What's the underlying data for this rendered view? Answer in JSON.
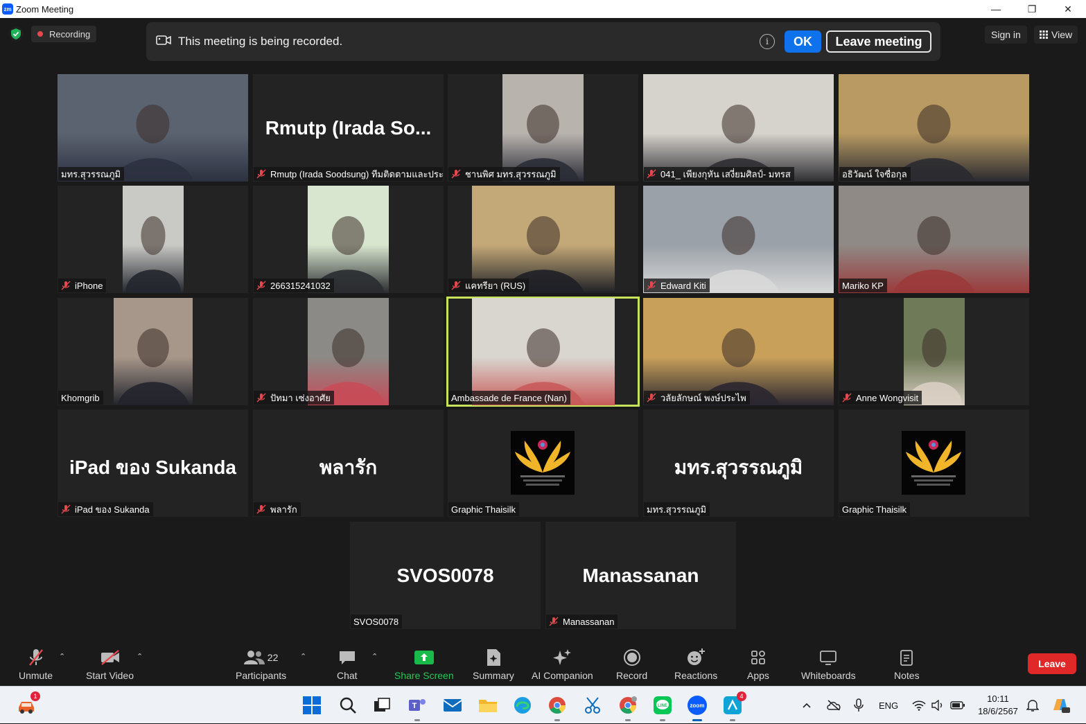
{
  "window": {
    "title": "Zoom Meeting",
    "logo_text": "zm",
    "minimize": "—",
    "maximize": "❐",
    "close": "✕"
  },
  "topbar": {
    "recording_label": "Recording",
    "banner_message": "This meeting is being recorded.",
    "ok_label": "OK",
    "leave_meeting_label": "Leave meeting",
    "sign_in_label": "Sign in",
    "view_label": "View"
  },
  "tiles": [
    {
      "label": "มทร.สุวรรณภูมิ",
      "type": "video",
      "muted": false,
      "bg": "#5b6270",
      "accent": "#2c3140"
    },
    {
      "label": "Rmutp (Irada Soodsung) ทีมติดตามและประ...",
      "type": "name",
      "display": "Rmutp (Irada So...",
      "muted": true
    },
    {
      "label": "ชานพิศ มทร.สุวรรณภูมิ",
      "type": "video",
      "muted": true,
      "bg": "#b9b3ae",
      "accent": "#2a2c36"
    },
    {
      "label": "041_ เพียงกุหัน เสงี่ยมศิลป์- มทรส",
      "type": "video",
      "muted": true,
      "bg": "#d6d2cc",
      "accent": "#2f2f33"
    },
    {
      "label": "อธิวัฒน์ ใจซื่อกุล",
      "type": "video",
      "muted": false,
      "bg": "#b89a62",
      "accent": "#2a2a30"
    },
    {
      "label": "iPhone",
      "type": "video",
      "muted": true,
      "bg": "#c9c9c5",
      "accent": "#24262e"
    },
    {
      "label": "266315241032",
      "type": "video",
      "muted": true,
      "bg": "#d8e6cf",
      "accent": "#2a2c30"
    },
    {
      "label": "แคทรียา (RUS)",
      "type": "video",
      "muted": true,
      "bg": "#c4a978",
      "accent": "#1f2026"
    },
    {
      "label": "Edward Kiti",
      "type": "video",
      "muted": true,
      "bg": "#9aa1a8",
      "accent": "#d8d8d8"
    },
    {
      "label": "Mariko KP",
      "type": "video",
      "muted": false,
      "bg": "#8f8a86",
      "accent": "#9b3a3a"
    },
    {
      "label": "Khomgrib",
      "type": "video",
      "muted": false,
      "bg": "#a7978a",
      "accent": "#22242c"
    },
    {
      "label": "ปัทมา เซ่งอาศัย",
      "type": "video",
      "muted": true,
      "bg": "#8b8a86",
      "accent": "#c74b58"
    },
    {
      "label": "Ambassade de France (Nan)",
      "type": "video",
      "muted": false,
      "active": true,
      "bg": "#d9d6d0",
      "accent": "#c85a5a"
    },
    {
      "label": "วลัยลักษณ์ พงษ์ประไพ",
      "type": "video",
      "muted": true,
      "bg": "#c8a05a",
      "accent": "#2b2730"
    },
    {
      "label": "Anne Wongvisit",
      "type": "video",
      "muted": true,
      "bg": "#6f7a58",
      "accent": "#d9cfc3"
    },
    {
      "label": "iPad ของ Sukanda",
      "type": "name",
      "display": "iPad ของ Sukanda",
      "muted": true
    },
    {
      "label": "พลารัก",
      "type": "name",
      "display": "พลารัก",
      "muted": true
    },
    {
      "label": "Graphic Thaisilk",
      "type": "logo",
      "muted": false
    },
    {
      "label": "มทร.สุวรรณภูมิ",
      "type": "name",
      "display": "มทร.สุวรรณภูมิ",
      "muted": false
    },
    {
      "label": "Graphic Thaisilk",
      "type": "logo",
      "muted": false
    },
    {
      "label": "SVOS0078",
      "type": "name",
      "display": "SVOS0078",
      "muted": false
    },
    {
      "label": "Manassanan",
      "type": "name",
      "display": "Manassanan",
      "muted": true
    }
  ],
  "toolbar": {
    "unmute": "Unmute",
    "start_video": "Start Video",
    "participants": "Participants",
    "participants_count": "22",
    "chat": "Chat",
    "share_screen": "Share Screen",
    "summary": "Summary",
    "ai_companion": "AI Companion",
    "record": "Record",
    "reactions": "Reactions",
    "apps": "Apps",
    "whiteboards": "Whiteboards",
    "notes": "Notes",
    "leave": "Leave"
  },
  "taskbar": {
    "language": "ENG",
    "time": "10:11",
    "date": "18/6/2567",
    "badges": {
      "weather": "1",
      "zoom_app": "4"
    }
  }
}
